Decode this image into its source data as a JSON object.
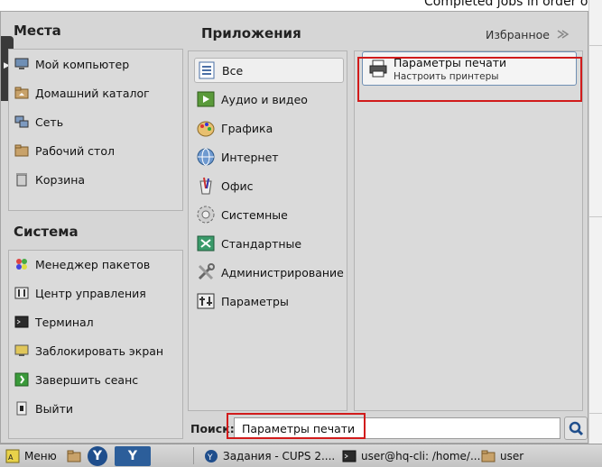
{
  "background": {
    "window_text": "Completed jobs in order of"
  },
  "places": {
    "title": "Места",
    "items": [
      {
        "label": "Мой компьютер",
        "icon": "computer-icon"
      },
      {
        "label": "Домашний каталог",
        "icon": "home-folder-icon"
      },
      {
        "label": "Сеть",
        "icon": "network-icon"
      },
      {
        "label": "Рабочий стол",
        "icon": "desktop-icon"
      },
      {
        "label": "Корзина",
        "icon": "trash-icon"
      }
    ]
  },
  "system": {
    "title": "Система",
    "items": [
      {
        "label": "Менеджер пакетов",
        "icon": "package-manager-icon"
      },
      {
        "label": "Центр управления",
        "icon": "control-center-icon"
      },
      {
        "label": "Терминал",
        "icon": "terminal-icon"
      },
      {
        "label": "Заблокировать экран",
        "icon": "lock-screen-icon"
      },
      {
        "label": "Завершить сеанс",
        "icon": "logout-icon"
      },
      {
        "label": "Выйти",
        "icon": "quit-icon"
      }
    ]
  },
  "applications": {
    "title": "Приложения",
    "favorites_label": "Избранное",
    "categories": [
      {
        "label": "Все",
        "icon": "all-apps-icon",
        "selected": true
      },
      {
        "label": "Аудио и видео",
        "icon": "multimedia-icon"
      },
      {
        "label": "Графика",
        "icon": "graphics-icon"
      },
      {
        "label": "Интернет",
        "icon": "internet-icon"
      },
      {
        "label": "Офис",
        "icon": "office-icon"
      },
      {
        "label": "Системные",
        "icon": "system-icon"
      },
      {
        "label": "Стандартные",
        "icon": "accessories-icon"
      },
      {
        "label": "Администрирование",
        "icon": "administration-icon"
      },
      {
        "label": "Параметры",
        "icon": "settings-icon"
      }
    ],
    "result": {
      "name": "Параметры печати",
      "description": "Настроить принтеры",
      "icon": "printer-icon"
    }
  },
  "search": {
    "label": "Поиск:",
    "value": "Параметры печати"
  },
  "taskbar": {
    "menu_label": "Меню",
    "tasks": [
      {
        "label": "Задания - CUPS 2....",
        "icon": "browser-icon"
      },
      {
        "label": "user@hq-cli: /home/...",
        "icon": "terminal-icon"
      },
      {
        "label": "user",
        "icon": "folder-icon"
      }
    ]
  },
  "colors": {
    "highlight": "#d11b1b",
    "selection_border": "#6f8fb3",
    "taskbar_blue": "#1f4e8c"
  }
}
